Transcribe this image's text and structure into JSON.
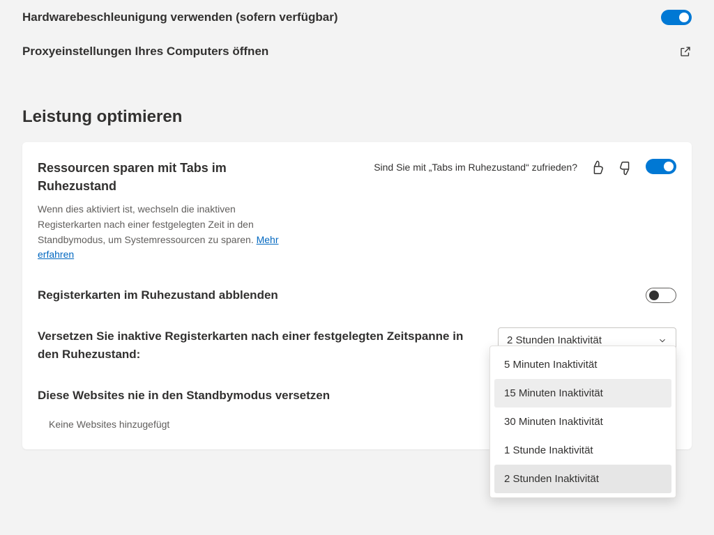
{
  "top": {
    "hw_accel_label": "Hardwarebeschleunigung verwenden (sofern verfügbar)",
    "proxy_label": "Proxyeinstellungen Ihres Computers öffnen"
  },
  "section": {
    "title": "Leistung optimieren"
  },
  "sleeping_tabs": {
    "title": "Ressourcen sparen mit Tabs im Ruhezustand",
    "desc_prefix": "Wenn dies aktiviert ist, wechseln die inaktiven Registerkarten nach einer festgelegten Zeit in den Standbymodus, um Systemressourcen zu sparen. ",
    "learn_more": "Mehr erfahren",
    "feedback_q": "Sind Sie mit „Tabs im Ruhezustand“ zufrieden?",
    "fade_label": "Registerkarten im Ruhezustand abblenden",
    "timeout_label": "Versetzen Sie inaktive Registerkarten nach einer festgelegten Zeitspanne in den Ruhezustand:",
    "timeout_selected": "2 Stunden Inaktivität",
    "timeout_options": {
      "0": "5 Minuten Inaktivität",
      "1": "15 Minuten Inaktivität",
      "2": "30 Minuten Inaktivität",
      "3": "1 Stunde Inaktivität",
      "4": "2 Stunden Inaktivität"
    },
    "never_sleep_label": "Diese Websites nie in den Standbymodus versetzen",
    "no_sites": "Keine Websites hinzugefügt"
  }
}
